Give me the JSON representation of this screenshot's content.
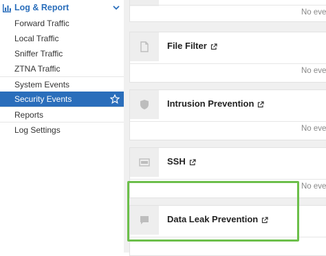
{
  "sidebar": {
    "section_title": "Log & Report",
    "items": [
      {
        "label": "Forward Traffic"
      },
      {
        "label": "Local Traffic"
      },
      {
        "label": "Sniffer Traffic"
      },
      {
        "label": "ZTNA Traffic"
      },
      {
        "label": "System Events"
      },
      {
        "label": "Security Events",
        "active": true
      },
      {
        "label": "Reports"
      },
      {
        "label": "Log Settings"
      }
    ],
    "accent_color": "#2a6ebb"
  },
  "cards": [
    {
      "title": "",
      "status": "No event"
    },
    {
      "title": "File Filter",
      "icon": "file-icon",
      "status": "No event"
    },
    {
      "title": "Intrusion Prevention",
      "icon": "shield-icon",
      "status": "No event"
    },
    {
      "title": "SSH",
      "icon": "ssh-icon",
      "status": "No event"
    },
    {
      "title": "Data Leak Prevention",
      "icon": "speech-bubble-icon",
      "status": ""
    }
  ],
  "highlight_color": "#6cbf4a"
}
